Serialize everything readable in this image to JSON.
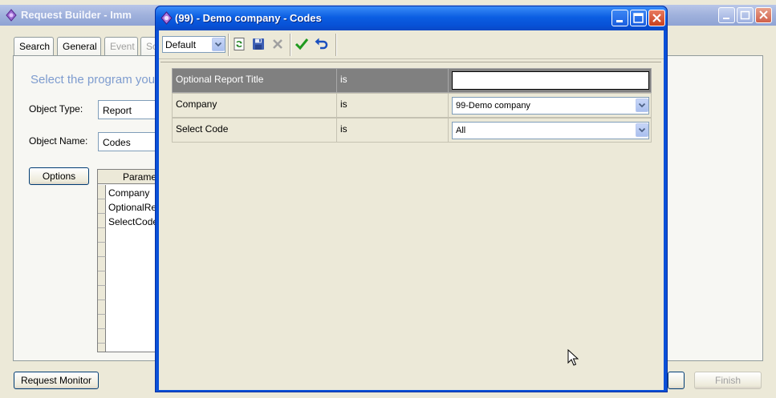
{
  "background_window": {
    "title": "Request Builder - Imm",
    "tabs": [
      {
        "label": "Search",
        "enabled": true
      },
      {
        "label": "General",
        "enabled": true
      },
      {
        "label": "Event",
        "enabled": false
      },
      {
        "label": "Sc",
        "enabled": false
      }
    ],
    "heading": "Select the program you",
    "object_type_label": "Object Type:",
    "object_type_value": "Report",
    "object_name_label": "Object Name:",
    "object_name_value": "Codes",
    "options_button": "Options",
    "grid": {
      "header": "Parame",
      "rows": [
        "Company",
        "OptionalRe",
        "SelectCode"
      ]
    },
    "request_monitor_button": "Request Monitor",
    "finish_button": "Finish"
  },
  "dialog": {
    "title": "(99) - Demo company -  Codes",
    "toolbar": {
      "layout_select_value": "Default",
      "icons": [
        "refresh-icon",
        "save-icon",
        "delete-icon",
        "accept-icon",
        "undo-icon"
      ]
    },
    "parameters": [
      {
        "name": "Optional Report Title",
        "operator": "is",
        "value": "",
        "control": "text",
        "selected": true
      },
      {
        "name": "Company",
        "operator": "is",
        "value": "99-Demo company",
        "control": "combo",
        "selected": false
      },
      {
        "name": "Select Code",
        "operator": "is",
        "value": "All",
        "control": "combo",
        "selected": false
      }
    ]
  },
  "colors": {
    "xp_title_blue": "#0b5ee2",
    "selected_row": "#808080",
    "window_bg": "#ece9d8",
    "heading_blue": "#7e9ccf"
  }
}
